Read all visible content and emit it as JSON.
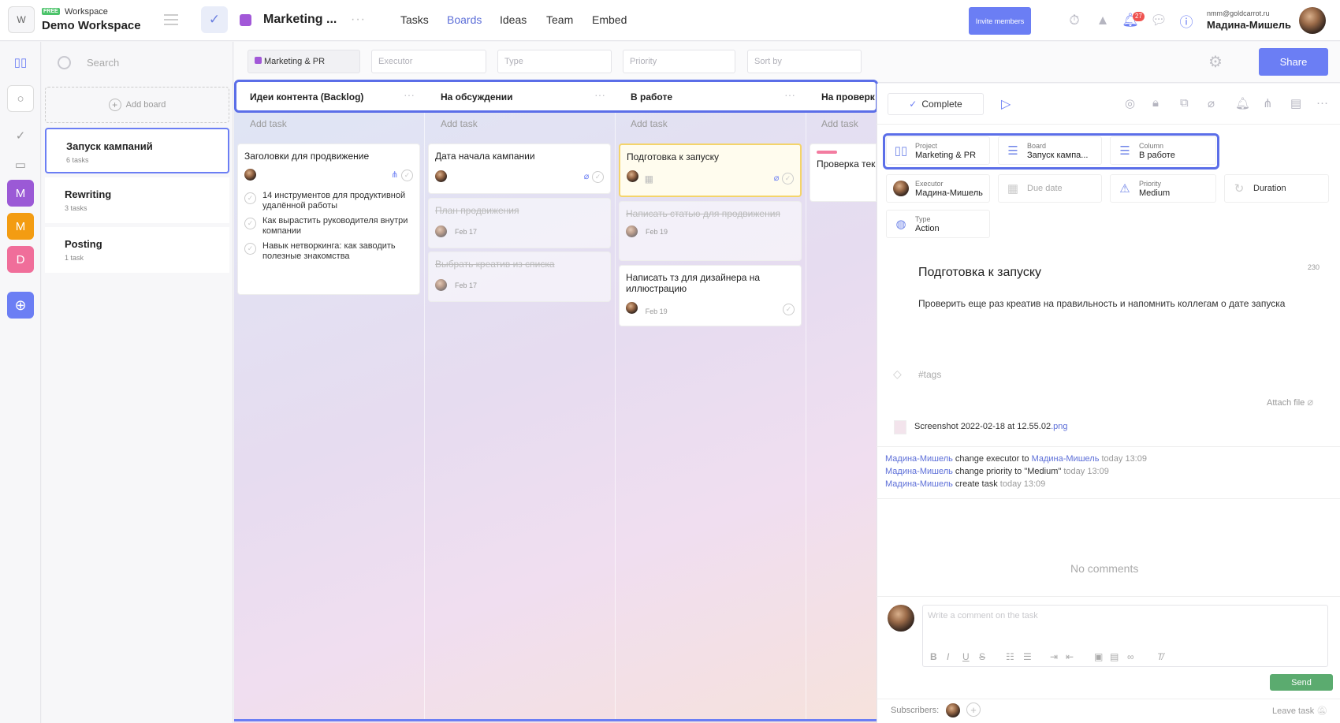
{
  "workspace": {
    "logo_letter": "W",
    "badge": "FREE",
    "label": "Workspace",
    "name": "Demo Workspace"
  },
  "project": {
    "name": "Marketing ...",
    "color": "#a258d8"
  },
  "nav": {
    "tasks": "Tasks",
    "boards": "Boards",
    "ideas": "Ideas",
    "team": "Team",
    "embed": "Embed"
  },
  "header": {
    "invite": "Invite members",
    "notif_count": "27",
    "user_email": "nmm@goldcarrot.ru",
    "user_name": "Мадина-Мишель"
  },
  "rail": {
    "m1": "M",
    "m2": "M",
    "d": "D",
    "m1_color": "#9b59d6",
    "m2_color": "#f39c12",
    "d_color": "#f06e9a"
  },
  "sidebar": {
    "search_placeholder": "Search",
    "add_board": "Add board",
    "boards": [
      {
        "title": "Запуск кампаний",
        "count": "6 tasks"
      },
      {
        "title": "Rewriting",
        "count": "3 tasks"
      },
      {
        "title": "Posting",
        "count": "1 task"
      }
    ]
  },
  "filters": {
    "project": "Marketing & PR",
    "executor": "Executor",
    "type": "Type",
    "priority": "Priority",
    "sort": "Sort by",
    "share": "Share"
  },
  "columns": [
    {
      "title": "Идеи контента (Backlog)",
      "add": "Add task"
    },
    {
      "title": "На обсуждении",
      "add": "Add task"
    },
    {
      "title": "В работе",
      "add": "Add task"
    },
    {
      "title": "На проверк",
      "add": "Add task"
    }
  ],
  "cards": {
    "c1": {
      "title": "Заголовки для продвижение",
      "subtasks": [
        "14 инструментов для продуктивной удалённой работы",
        "Как вырастить руководителя внутри компании",
        "Навык нетворкинга: как заводить полезные знакомства"
      ]
    },
    "c2": {
      "title": "Дата начала кампании"
    },
    "c3": {
      "title": "План продвижения",
      "date": "Feb 17"
    },
    "c4": {
      "title": "Выбрать креатив из списка",
      "date": "Feb 17"
    },
    "c5": {
      "title": "Подготовка к запуску"
    },
    "c6": {
      "title": "Написать статью для продвижения",
      "date": "Feb 19"
    },
    "c7": {
      "title": "Написать тз для дизайнера на иллюстрацию",
      "date": "Feb 19"
    },
    "c8": {
      "title": "Проверка тек"
    }
  },
  "detail": {
    "complete": "Complete",
    "project_label": "Project",
    "project_value": "Marketing & PR",
    "board_label": "Board",
    "board_value": "Запуск кампа...",
    "column_label": "Column",
    "column_value": "В работе",
    "executor_label": "Executor",
    "executor_value": "Мадина-Мишель",
    "due_date": "Due date",
    "priority_label": "Priority",
    "priority_value": "Medium",
    "duration": "Duration",
    "type_label": "Type",
    "type_value": "Action",
    "title": "Подготовка к запуску",
    "char_count": "230",
    "description": "Проверить еще раз креатив на правильность и напомнить коллегам о дате запуска",
    "tags": "#tags",
    "attach": "Attach file",
    "file_name": "Screenshot 2022-02-18 at 12.55.02",
    "file_ext": ".png",
    "history": [
      {
        "user": "Мадина-Мишель",
        "action": "change executor to",
        "target": "Мадина-Мишель",
        "time": "today 13:09"
      },
      {
        "user": "Мадина-Мишель",
        "action": "change priority to \"Medium\"",
        "target": "",
        "time": "today 13:09"
      },
      {
        "user": "Мадина-Мишель",
        "action": "create task",
        "target": "",
        "time": "today 13:09"
      }
    ],
    "no_comments": "No comments",
    "comment_placeholder": "Write a comment on the task",
    "send": "Send",
    "subscribers": "Subscribers:",
    "leave": "Leave task"
  }
}
